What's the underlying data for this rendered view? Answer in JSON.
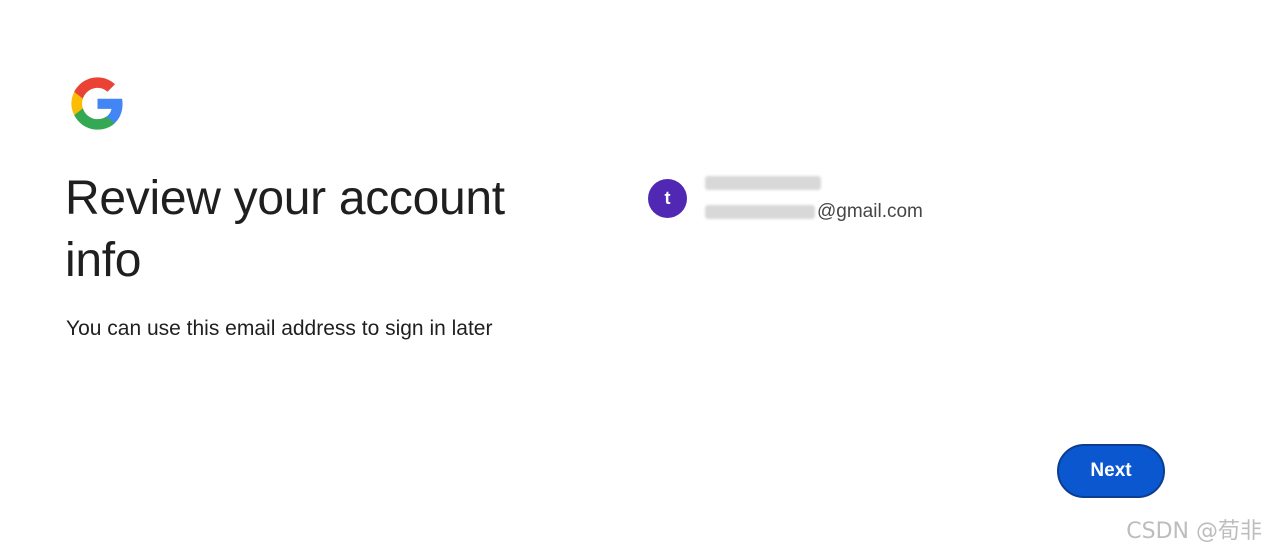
{
  "brand": {
    "logo_icon": "google-g-icon",
    "colors": {
      "blue": "#4285F4",
      "red": "#EA4335",
      "yellow": "#FBBC05",
      "green": "#34A853"
    }
  },
  "page": {
    "title": "Review your account info",
    "subtitle": "You can use this email address to sign in later"
  },
  "account": {
    "avatar_letter": "t",
    "avatar_color": "#5028B4",
    "email_suffix": "@gmail.com"
  },
  "actions": {
    "next_label": "Next",
    "accent_color": "#0B57D0"
  },
  "watermark": "CSDN @荀非"
}
